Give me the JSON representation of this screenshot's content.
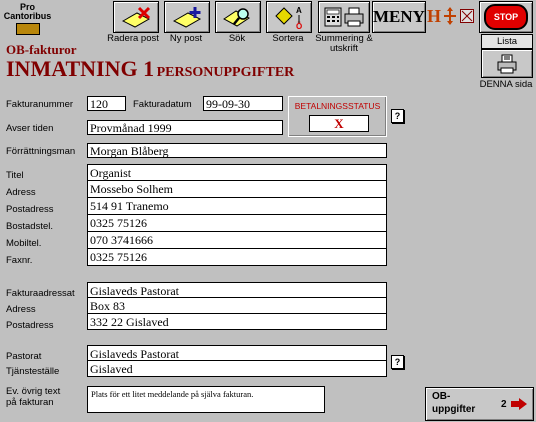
{
  "logo": {
    "line1": "Pro",
    "line2": "Cantoribus"
  },
  "toolbar": {
    "radera": "Radera post",
    "ny": "Ny post",
    "sok": "Sök",
    "sortera": "Sortera",
    "summering": "Summering & utskrift",
    "meny": "MENY",
    "stop": "STOP",
    "lista": "Lista",
    "denna": "DENNA sida"
  },
  "header": {
    "subtitle": "OB-fakturor",
    "title": "INMATNING 1",
    "title_small": "PERSONUPPGIFTER"
  },
  "invoice": {
    "nr_label": "Fakturanummer",
    "nr": "120",
    "date_label": "Fakturadatum",
    "date": "99-09-30",
    "avser_label": "Avser tiden",
    "avser": "Provmånad 1999"
  },
  "status": {
    "label": "BETALNINGSSTATUS",
    "value": "X"
  },
  "person": {
    "forrattning_label": "Förrättningsman",
    "forrattning": "Morgan Blåberg",
    "titel_label": "Titel",
    "titel": "Organist",
    "adress_label": "Adress",
    "adress": "Mossebo Solhem",
    "postadress_label": "Postadress",
    "postadress": "514 91 Tranemo",
    "bostadstel_label": "Bostadstel.",
    "bostadstel": "0325 75126",
    "mobiltel_label": "Mobiltel.",
    "mobiltel": "070 3741666",
    "fax_label": "Faxnr.",
    "fax": "0325 75126"
  },
  "billing": {
    "fakturaadress_label": "Fakturaadressat",
    "fakturaadress": "Gislaveds Pastorat",
    "adress_label": "Adress",
    "adress": "Box 83",
    "postadress_label": "Postadress",
    "postadress": "332 22 Gislaved"
  },
  "pastorat": {
    "pastorat_label": "Pastorat",
    "pastorat": "Gislaveds Pastorat",
    "tjanst_label": "Tjänsteställe",
    "tjanst": "Gislaved"
  },
  "note": {
    "label1": "Ev. övrig text",
    "label2": "på fakturan",
    "text": "Plats för ett litet meddelande på själva fakturan."
  },
  "nav": {
    "label1": "OB-",
    "label2": "uppgifter",
    "page": "2"
  },
  "help_icon": "?",
  "colors": {
    "title": "#800000",
    "status": "#c00000",
    "stop": "#e00000"
  }
}
